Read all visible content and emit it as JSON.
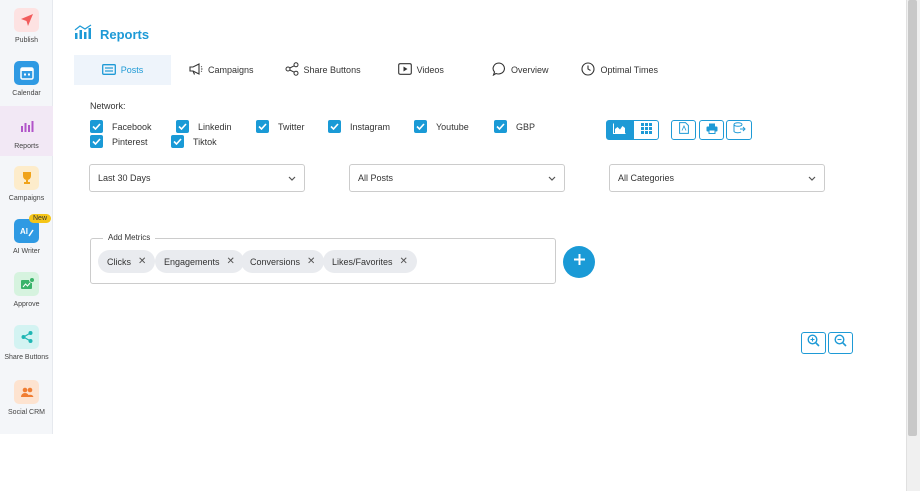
{
  "sidebar": {
    "items": [
      {
        "label": "Publish",
        "icon": "paper-plane-icon",
        "color": "#f25c5c",
        "bg": "#fde2e2"
      },
      {
        "label": "Calendar",
        "icon": "calendar-icon",
        "color": "#ffffff",
        "bg": "#2f9ae3"
      },
      {
        "label": "Reports",
        "icon": "bar-chart-icon",
        "color": "#b255c9",
        "bg": "#f2e8f5"
      },
      {
        "label": "Campaigns",
        "icon": "trophy-icon",
        "color": "#f0a31a",
        "bg": "#fdeccb"
      },
      {
        "label": "AI Writer",
        "icon": "ai-writer-icon",
        "color": "#2f9ae3",
        "bg": "#dcefff"
      },
      {
        "label": "Approve",
        "icon": "approve-icon",
        "color": "#3ab36a",
        "bg": "#d6f3df"
      },
      {
        "label": "Share Buttons",
        "icon": "share-icon",
        "color": "#1fb6b4",
        "bg": "#d3f3f2"
      },
      {
        "label": "Social CRM",
        "icon": "users-icon",
        "color": "#f07d32",
        "bg": "#fde3d0"
      }
    ],
    "new_badge": "New"
  },
  "header": {
    "title": "Reports",
    "icon": "reports-chart-icon"
  },
  "tabs": [
    {
      "label": "Posts",
      "icon": "posts-icon"
    },
    {
      "label": "Campaigns",
      "icon": "megaphone-icon"
    },
    {
      "label": "Share Buttons",
      "icon": "share-icon"
    },
    {
      "label": "Videos",
      "icon": "video-icon"
    },
    {
      "label": "Overview",
      "icon": "speech-bubble-icon"
    },
    {
      "label": "Optimal Times",
      "icon": "clock-icon"
    }
  ],
  "network": {
    "label": "Network:",
    "options": [
      {
        "label": "Facebook",
        "checked": true
      },
      {
        "label": "Linkedin",
        "checked": true
      },
      {
        "label": "Twitter",
        "checked": true
      },
      {
        "label": "Instagram",
        "checked": true
      },
      {
        "label": "Youtube",
        "checked": true
      },
      {
        "label": "GBP",
        "checked": true
      },
      {
        "label": "Pinterest",
        "checked": true
      },
      {
        "label": "Tiktok",
        "checked": true
      }
    ]
  },
  "filters": {
    "date_range": "Last 30 Days",
    "posts": "All Posts",
    "categories": "All Categories"
  },
  "metrics": {
    "legend": "Add Metrics",
    "chips": [
      "Clicks",
      "Engagements",
      "Conversions",
      "Likes/Favorites"
    ]
  },
  "colors": {
    "accent": "#1e9ad6"
  }
}
